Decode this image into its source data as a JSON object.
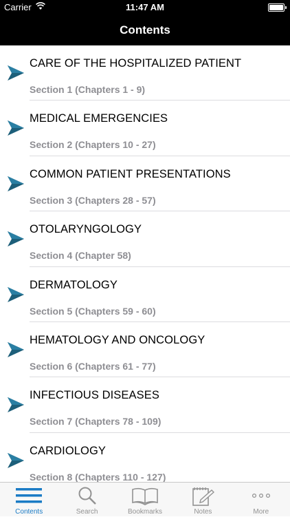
{
  "status_bar": {
    "carrier": "Carrier",
    "time": "11:47 AM"
  },
  "nav": {
    "title": "Contents"
  },
  "sections": [
    {
      "title": "CARE OF THE HOSPITALIZED PATIENT",
      "subtitle": "Section 1 (Chapters 1 - 9)"
    },
    {
      "title": "MEDICAL EMERGENCIES",
      "subtitle": "Section 2 (Chapters 10 - 27)"
    },
    {
      "title": "COMMON PATIENT PRESENTATIONS",
      "subtitle": "Section 3 (Chapters 28 - 57)"
    },
    {
      "title": "OTOLARYNGOLOGY",
      "subtitle": "Section 4 (Chapter 58)"
    },
    {
      "title": "DERMATOLOGY",
      "subtitle": "Section 5 (Chapters 59 - 60)"
    },
    {
      "title": "HEMATOLOGY AND ONCOLOGY",
      "subtitle": "Section 6 (Chapters 61 - 77)"
    },
    {
      "title": "INFECTIOUS DISEASES",
      "subtitle": "Section 7 (Chapters 78 - 109)"
    },
    {
      "title": "CARDIOLOGY",
      "subtitle": "Section 8 (Chapters 110 - 127)"
    }
  ],
  "tabs": [
    {
      "label": "Contents",
      "icon": "list-icon",
      "active": true
    },
    {
      "label": "Search",
      "icon": "search-icon",
      "active": false
    },
    {
      "label": "Bookmarks",
      "icon": "book-icon",
      "active": false
    },
    {
      "label": "Notes",
      "icon": "notepad-icon",
      "active": false
    },
    {
      "label": "More",
      "icon": "more-icon",
      "active": false
    }
  ],
  "colors": {
    "active_tab": "#1a7bc5",
    "inactive_tab": "#929292",
    "chevron": "#1d5f7a"
  }
}
